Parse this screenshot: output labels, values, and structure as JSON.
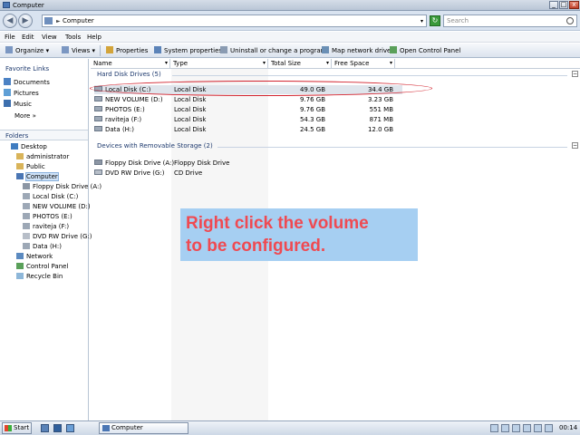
{
  "window": {
    "title": "Computer",
    "minimize": "_",
    "maximize": "□",
    "close": "x"
  },
  "address": {
    "back": "◀",
    "forward": "▶",
    "separator": "►",
    "path": "Computer",
    "dropdown": "▾",
    "refresh": "↻",
    "search_placeholder": "Search"
  },
  "menu": [
    "File",
    "Edit",
    "View",
    "Tools",
    "Help"
  ],
  "commands": [
    "Organize ▾",
    "Views ▾",
    "Properties",
    "System properties",
    "Uninstall or change a program",
    "Map network drive",
    "Open Control Panel"
  ],
  "favorites": {
    "title": "Favorite Links",
    "items": [
      "Documents",
      "Pictures",
      "Music"
    ],
    "more": "More  »"
  },
  "folders_label": "Folders",
  "tree": [
    "Desktop",
    "administrator",
    "Public",
    "Computer",
    "Floppy Disk Drive (A:)",
    "Local Disk (C:)",
    "NEW VOLUME (D:)",
    "PHOTOS (E:)",
    "raviteja (F:)",
    "DVD RW Drive (G:)",
    "Data (H:)",
    "Network",
    "Control Panel",
    "Recycle Bin"
  ],
  "columns": [
    "Name",
    "Type",
    "Total Size",
    "Free Space"
  ],
  "groups": {
    "hard_disks": "Hard Disk Drives (5)",
    "removable": "Devices with Removable Storage (2)"
  },
  "drives": [
    {
      "name": "Local Disk (C:)",
      "type": "Local Disk",
      "total": "49.0 GB",
      "free": "34.4 GB"
    },
    {
      "name": "NEW VOLUME (D:)",
      "type": "Local Disk",
      "total": "9.76 GB",
      "free": "3.23 GB"
    },
    {
      "name": "PHOTOS (E:)",
      "type": "Local Disk",
      "total": "9.76 GB",
      "free": "551 MB"
    },
    {
      "name": "raviteja (F:)",
      "type": "Local Disk",
      "total": "54.3 GB",
      "free": "871 MB"
    },
    {
      "name": "Data (H:)",
      "type": "Local Disk",
      "total": "24.5 GB",
      "free": "12.0 GB"
    }
  ],
  "removable": [
    {
      "name": "Floppy Disk Drive (A:)",
      "type": "Floppy Disk Drive"
    },
    {
      "name": "DVD RW Drive (G:)",
      "type": "CD Drive"
    }
  ],
  "annotation": {
    "line1": "Right click the volume",
    "line2": "to be configured."
  },
  "taskbar": {
    "start": "Start",
    "task": "Computer",
    "clock": "00:14"
  },
  "colors": {
    "annotation_bg": "#a6cff2",
    "annotation_text": "#ef4a52",
    "highlight": "#d3242f"
  }
}
